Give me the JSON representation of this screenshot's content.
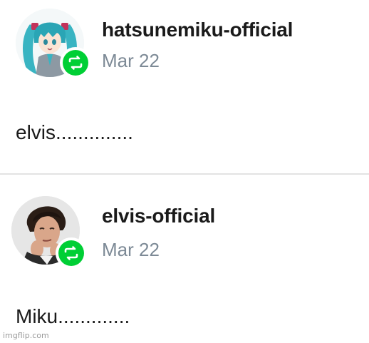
{
  "posts": [
    {
      "username": "hatsunemiku-official",
      "date": "Mar 22",
      "body": "elvis..............",
      "avatar_icon": "hatsune-miku-avatar",
      "badge_icon": "reblog-icon"
    },
    {
      "username": "elvis-official",
      "date": "Mar 22",
      "body": "Miku.............",
      "avatar_icon": "elvis-avatar",
      "badge_icon": "reblog-icon"
    }
  ],
  "watermark": "imgflip.com",
  "colors": {
    "reblog_green": "#00cf35",
    "date_gray": "#7d8a96",
    "divider": "#e3e3e3"
  }
}
